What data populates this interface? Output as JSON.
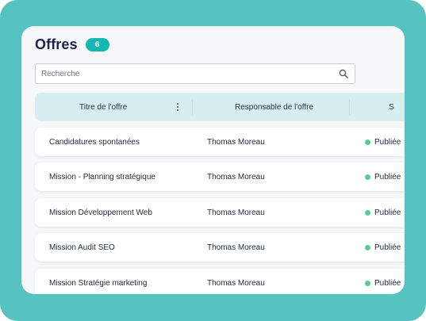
{
  "header": {
    "title": "Offres",
    "count": "6"
  },
  "search": {
    "placeholder": "Recherche",
    "icon": "search-icon"
  },
  "table": {
    "columns": [
      "Titre de l'offre",
      "Responsable de l'offre",
      "S"
    ],
    "rows": [
      {
        "title": "Candidatures spontanées",
        "responsable": "Thomas Moreau",
        "status": "Publiée"
      },
      {
        "title": "Mission - Planning stratégique",
        "responsable": "Thomas Moreau",
        "status": "Publiée"
      },
      {
        "title": "Mission Développement Web",
        "responsable": "Thomas Moreau",
        "status": "Publiée"
      },
      {
        "title": "Mission Audit SEO",
        "responsable": "Thomas Moreau",
        "status": "Publiée"
      },
      {
        "title": "Mission Stratégie marketing",
        "responsable": "Thomas Moreau",
        "status": "Publiée"
      }
    ]
  },
  "colors": {
    "frame": "#57c3c1",
    "accent": "#14b8b0",
    "header_bg": "#d7eef1",
    "status_published": "#5cc98f"
  }
}
